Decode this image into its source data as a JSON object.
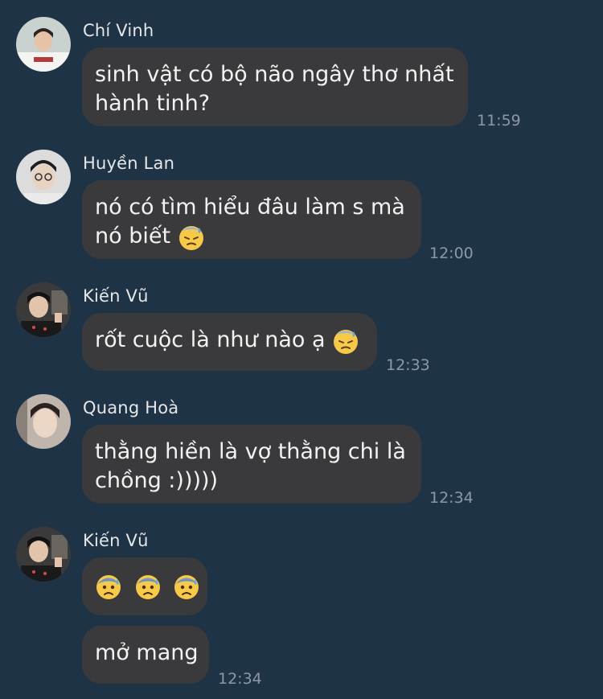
{
  "messages": [
    {
      "sender": "Chí Vinh",
      "avatar_icon": "avatar-chi-vinh",
      "lines": [
        "sinh vật có bộ não ngây thơ nhất",
        "hành tinh?"
      ],
      "time": "11:59"
    },
    {
      "sender": "Huyền Lan",
      "avatar_icon": "avatar-huyen-lan",
      "lines": [
        "nó có tìm hiểu đâu làm s mà",
        "nó biết"
      ],
      "emoji": "downcast-face-with-sweat",
      "time": "12:00"
    },
    {
      "sender": "Kiến Vũ",
      "avatar_icon": "avatar-kien-vu",
      "lines": [
        "rốt cuộc là như nào ạ"
      ],
      "emoji": "downcast-face-with-sweat",
      "time": "12:33"
    },
    {
      "sender": "Quang Hoà",
      "avatar_icon": "avatar-quang-hoa",
      "lines": [
        "thằng hiền là vợ thằng chi là",
        "chồng :)))))"
      ],
      "time": "12:34"
    },
    {
      "sender": "Kiến Vũ",
      "avatar_icon": "avatar-kien-vu",
      "emoji_row": [
        "anxious-face-with-sweat",
        "anxious-face-with-sweat",
        "anxious-face-with-sweat"
      ],
      "lines": [
        "mở mang"
      ],
      "time": "12:34"
    }
  ],
  "colors": {
    "background": "#1f3347",
    "bubble": "#3a3a3c",
    "text": "#f2f2f2",
    "timestamp": "#8c98a5"
  }
}
